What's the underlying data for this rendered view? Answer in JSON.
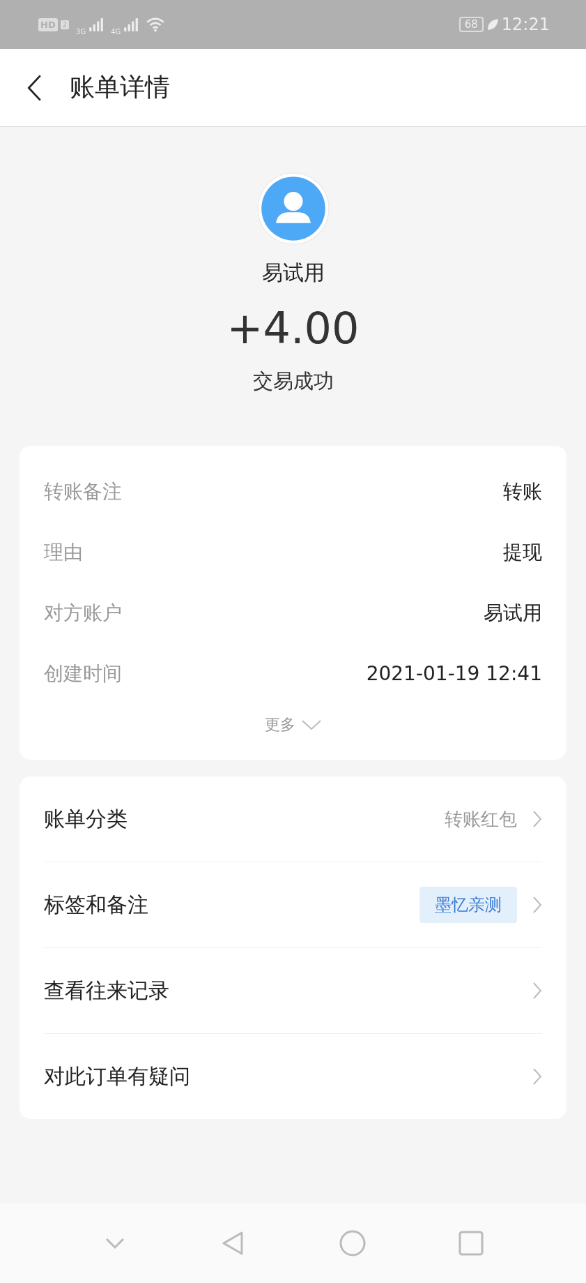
{
  "status_bar": {
    "network_labels": [
      "HD",
      "2",
      "3G",
      "4G"
    ],
    "battery": "68",
    "time": "12:21"
  },
  "header": {
    "title": "账单详情"
  },
  "party": {
    "name": "易试用",
    "amount": "+4.00",
    "status": "交易成功"
  },
  "details": [
    {
      "label": "转账备注",
      "value": "转账"
    },
    {
      "label": "理由",
      "value": "提现"
    },
    {
      "label": "对方账户",
      "value": "易试用"
    },
    {
      "label": "创建时间",
      "value": "2021-01-19 12:41"
    }
  ],
  "more": "更多",
  "actions": [
    {
      "label": "账单分类",
      "kind": "text",
      "value": "转账红包"
    },
    {
      "label": "标签和备注",
      "kind": "tag",
      "value": "墨忆亲测"
    },
    {
      "label": "查看往来记录",
      "kind": "plain"
    },
    {
      "label": "对此订单有疑问",
      "kind": "plain"
    }
  ]
}
